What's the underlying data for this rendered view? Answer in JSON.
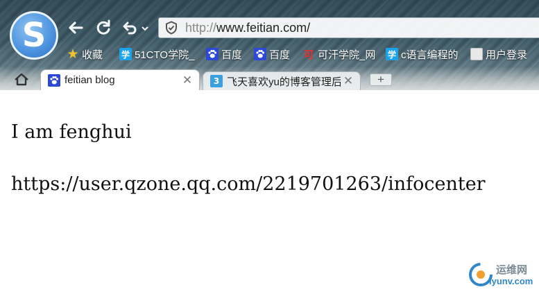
{
  "browser": {
    "logo_letter": "S",
    "address": {
      "protocol": "http://",
      "url": "www.feitian.com/"
    },
    "bookmarks": [
      {
        "label": "收藏",
        "icon": "star-icon"
      },
      {
        "label": "51CTO学院_",
        "icon": "xue-icon",
        "glyph": "学"
      },
      {
        "label": "百度",
        "icon": "baidu-paw-icon"
      },
      {
        "label": "百度",
        "icon": "baidu-paw-icon"
      },
      {
        "label": "可汗学院_网",
        "icon": "khan-icon",
        "glyph": "可"
      },
      {
        "label": "c语言编程的",
        "icon": "xue-icon",
        "glyph": "学"
      },
      {
        "label": "用户登录",
        "icon": "user-page-icon"
      }
    ],
    "tabs": [
      {
        "title": "feitian blog",
        "active": true,
        "icon": "baidu-paw-icon"
      },
      {
        "title": "飞天喜欢yu的博客管理后",
        "active": false,
        "icon": "qzone-icon",
        "glyph": "3"
      }
    ],
    "new_tab_label": "+"
  },
  "page": {
    "line1": "I am fenghui",
    "line2": "https://user.qzone.qq.com/2219701263/infocenter"
  },
  "watermark": {
    "cn": "运维网",
    "en": "iyunv.com"
  },
  "colors": {
    "accent_blue": "#4f95e0",
    "paw_blue": "#2b48d6",
    "xue_blue": "#1aa3e8"
  }
}
